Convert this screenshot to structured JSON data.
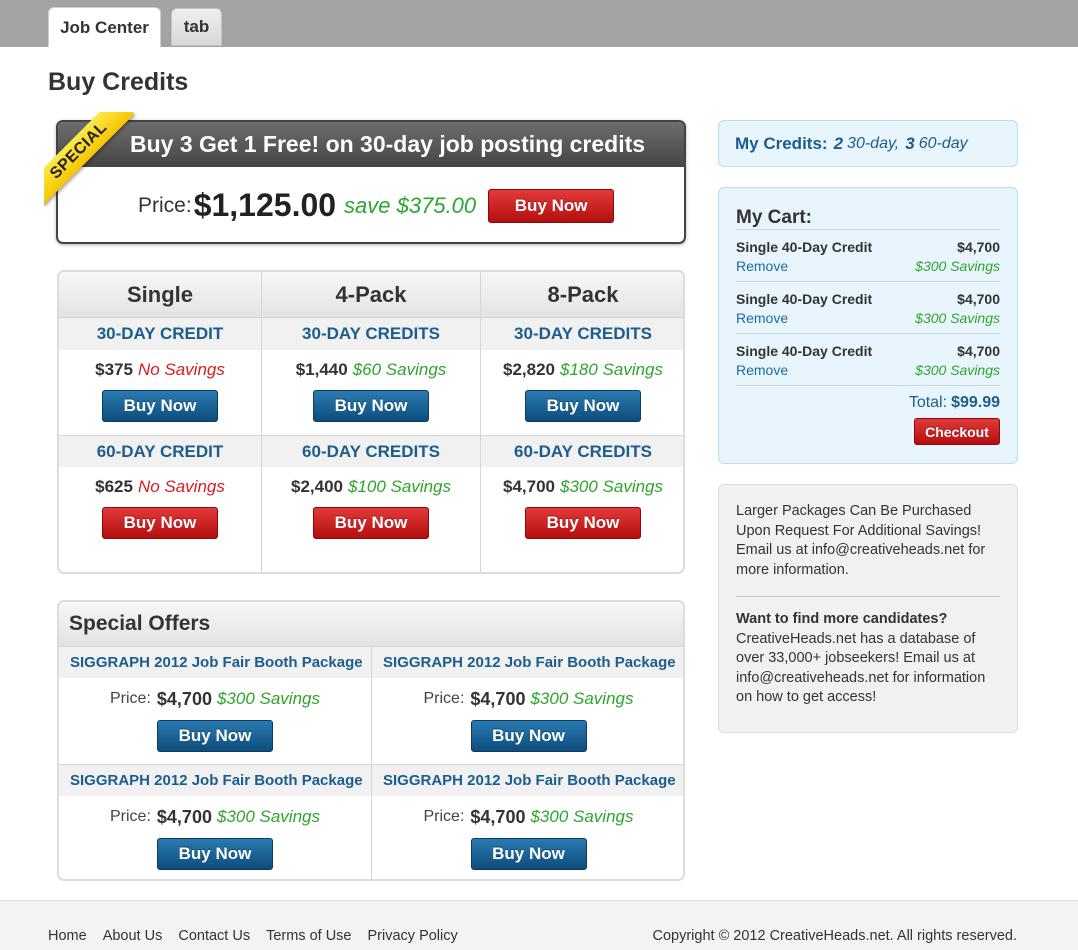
{
  "tabs": [
    {
      "label": "Job Center",
      "active": true
    },
    {
      "label": "tab",
      "active": false
    }
  ],
  "page_title": "Buy Credits",
  "special": {
    "ribbon": "SPECIAL",
    "headline": "Buy 3 Get 1 Free! on 30-day job posting credits",
    "price_label": "Price:",
    "price": "$1,125.00",
    "save": "save $375.00",
    "button": "Buy Now"
  },
  "packages": {
    "columns": [
      {
        "title": "Single",
        "rows": [
          {
            "label": "30-DAY CREDIT",
            "price": "$375",
            "savings": "No Savings",
            "savings_color": "red",
            "button": "Buy Now",
            "button_color": "blue"
          },
          {
            "label": "60-DAY CREDIT",
            "price": "$625",
            "savings": "No Savings",
            "savings_color": "red",
            "button": "Buy Now",
            "button_color": "red"
          }
        ]
      },
      {
        "title": "4-Pack",
        "rows": [
          {
            "label": "30-DAY CREDITS",
            "price": "$1,440",
            "savings": "$60 Savings",
            "savings_color": "green",
            "button": "Buy Now",
            "button_color": "blue"
          },
          {
            "label": "60-DAY CREDITS",
            "price": "$2,400",
            "savings": "$100 Savings",
            "savings_color": "green",
            "button": "Buy Now",
            "button_color": "red"
          }
        ]
      },
      {
        "title": "8-Pack",
        "rows": [
          {
            "label": "30-DAY CREDITS",
            "price": "$2,820",
            "savings": "$180 Savings",
            "savings_color": "green",
            "button": "Buy Now",
            "button_color": "blue"
          },
          {
            "label": "60-DAY CREDITS",
            "price": "$4,700",
            "savings": "$300 Savings",
            "savings_color": "green",
            "button": "Buy Now",
            "button_color": "red"
          }
        ]
      }
    ]
  },
  "offers": {
    "title": "Special Offers",
    "items": [
      {
        "name": "SIGGRAPH 2012 Job Fair Booth Package",
        "price_label": "Price:",
        "price": "$4,700",
        "savings": "$300 Savings",
        "button": "Buy Now"
      },
      {
        "name": "SIGGRAPH 2012 Job Fair Booth Package",
        "price_label": "Price:",
        "price": "$4,700",
        "savings": "$300 Savings",
        "button": "Buy Now"
      },
      {
        "name": "SIGGRAPH 2012 Job Fair Booth Package",
        "price_label": "Price:",
        "price": "$4,700",
        "savings": "$300 Savings",
        "button": "Buy Now"
      },
      {
        "name": "SIGGRAPH 2012 Job Fair Booth Package",
        "price_label": "Price:",
        "price": "$4,700",
        "savings": "$300 Savings",
        "button": "Buy Now"
      }
    ]
  },
  "my_credits": {
    "label": "My Credits:",
    "count_30": "2",
    "unit_30": "30-day,",
    "count_60": "3",
    "unit_60": "60-day"
  },
  "cart": {
    "title": "My Cart:",
    "items": [
      {
        "name": "Single 40-Day Credit",
        "price": "$4,700",
        "remove": "Remove",
        "savings": "$300 Savings"
      },
      {
        "name": "Single 40-Day Credit",
        "price": "$4,700",
        "remove": "Remove",
        "savings": "$300 Savings"
      },
      {
        "name": "Single 40-Day Credit",
        "price": "$4,700",
        "remove": "Remove",
        "savings": "$300 Savings"
      }
    ],
    "total_label": "Total:",
    "total": "$99.99",
    "checkout": "Checkout"
  },
  "info": {
    "paragraph1": "Larger Packages Can Be Purchased Upon Request For Additional Savings! Email us at info@creativeheads.net for more information.",
    "question": "Want to find more candidates?",
    "paragraph2": "CreativeHeads.net has a database of over 33,000+ jobseekers! Email us at info@creativeheads.net for information on how to get access!"
  },
  "footer": {
    "links": [
      "Home",
      "About Us",
      "Contact Us",
      "Terms of Use",
      "Privacy Policy"
    ],
    "copyright": "Copyright © 2012 CreativeHeads.net. All rights reserved."
  },
  "colors": {
    "accent_blue": "#1b5d8c",
    "savings_green": "#2ea52e",
    "no_savings_red": "#d42020",
    "button_red": "#c41c1c",
    "button_blue": "#145c8e",
    "ribbon_yellow": "#f8d400"
  }
}
